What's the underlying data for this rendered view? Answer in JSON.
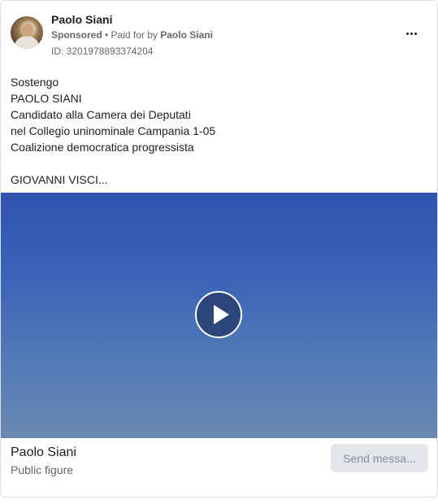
{
  "post": {
    "author_name": "Paolo Siani",
    "sponsored_label": "Sponsored",
    "separator": " • ",
    "paid_for_prefix": "Paid for by ",
    "paid_for_name": "Paolo Siani",
    "ad_id": "ID: 3201978893374204",
    "more_icon": "more-horizontal-icon",
    "body_lines": [
      "Sostengo",
      "PAOLO SIANI",
      "Candidato alla Camera dei Deputati",
      "nel Collegio uninominale Campania 1-05",
      "Coalizione democratica progressista",
      "",
      "GIOVANNI VISCI..."
    ]
  },
  "media": {
    "play_icon": "play-icon",
    "gradient_top": "#2f55b0",
    "gradient_bottom": "#6a88b2"
  },
  "footer": {
    "title": "Paolo Siani",
    "subtitle": "Public figure",
    "cta_label": "Send messa..."
  }
}
